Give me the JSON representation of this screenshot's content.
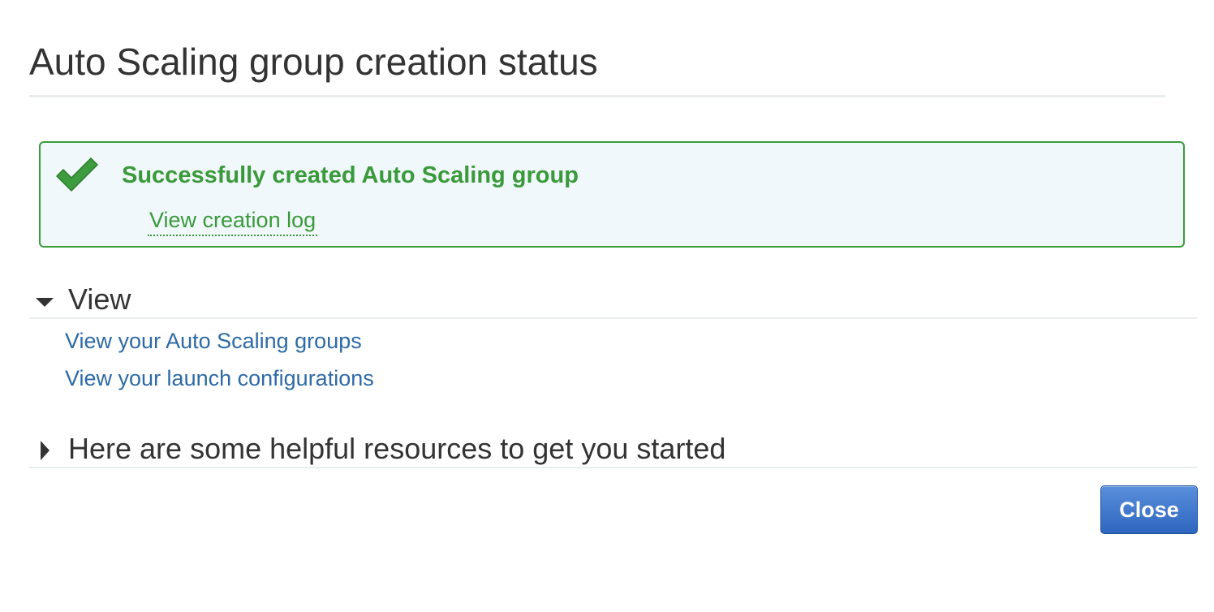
{
  "page": {
    "title": "Auto Scaling group creation status"
  },
  "status": {
    "icon": "check-icon",
    "message": "Successfully created Auto Scaling group",
    "log_link": "View creation log",
    "color": "#3a9a3a",
    "background": "#f0f8fc"
  },
  "view_section": {
    "title": "View",
    "expanded": true,
    "links": [
      {
        "label": "View your Auto Scaling groups"
      },
      {
        "label": "View your launch configurations"
      }
    ]
  },
  "resources_section": {
    "title": "Here are some helpful resources to get you started",
    "expanded": false
  },
  "actions": {
    "close_label": "Close"
  },
  "colors": {
    "link": "#2d6aa6",
    "primary_button": "#2f66be",
    "success": "#3a9a3a"
  }
}
